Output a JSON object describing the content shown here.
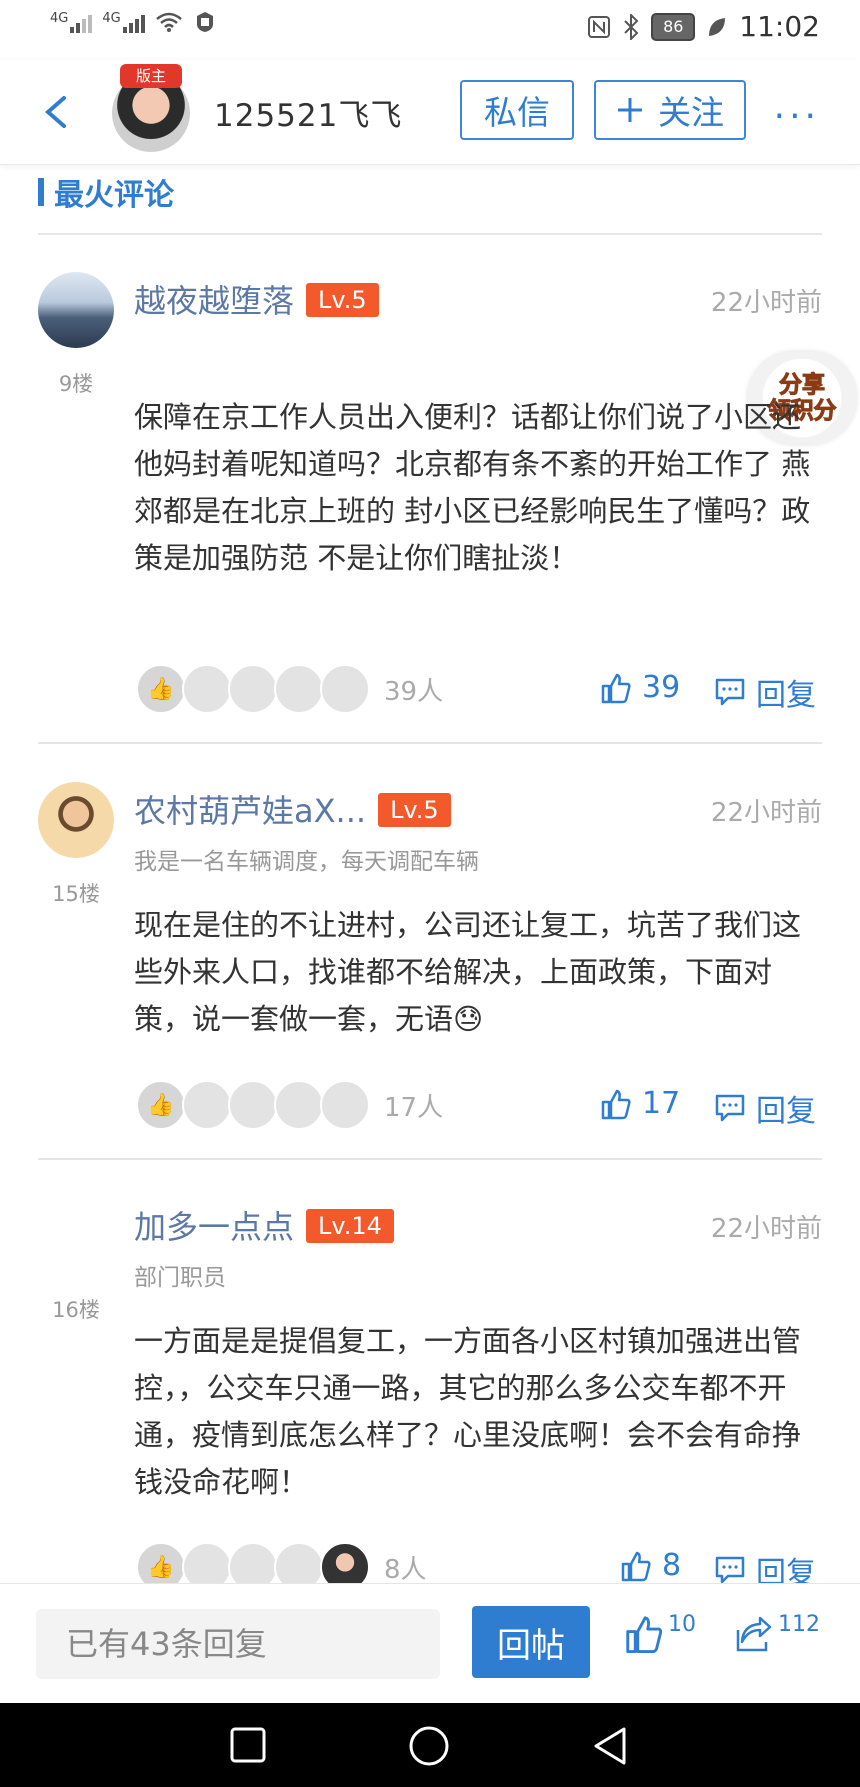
{
  "status_bar": {
    "time": "11:02",
    "battery": "86",
    "signal1": "4G",
    "signal2": "4G"
  },
  "header": {
    "username": "125521飞飞",
    "badge": "版主",
    "message_button": "私信",
    "follow_button": "关注",
    "more": "···"
  },
  "section_title": "最火评论",
  "share_badge": {
    "line1": "分享",
    "line2": "领积分"
  },
  "comments": [
    {
      "name": "越夜越堕落",
      "level": "Lv.5",
      "time": "22小时前",
      "floor": "9楼",
      "subtitle": "",
      "body": "保障在京工作人员出入便利？话都让你们说了小区还他妈封着呢知道吗？北京都有条不紊的开始工作了 燕郊都是在北京上班的 封小区已经影响民生了懂吗？政策是加强防范 不是让你们瞎扯淡！",
      "liker_count": "39人",
      "likes": "39",
      "reply": "回复"
    },
    {
      "name": "农村葫芦娃aX...",
      "level": "Lv.5",
      "time": "22小时前",
      "floor": "15楼",
      "subtitle": "我是一名车辆调度，每天调配车辆",
      "body": "现在是住的不让进村，公司还让复工，坑苦了我们这些外来人口，找谁都不给解决，上面政策，下面对策，说一套做一套，无语😓",
      "liker_count": "17人",
      "likes": "17",
      "reply": "回复"
    },
    {
      "name": "加多一点点",
      "level": "Lv.14",
      "time": "22小时前",
      "floor": "16楼",
      "subtitle": "部门职员",
      "body": "一方面是是提倡复工，一方面各小区村镇加强进出管控，，公交车只通一路，其它的那么多公交车都不开通，疫情到底怎么样了？心里没底啊！会不会有命挣钱没命花啊！",
      "liker_count": "8人",
      "likes": "8",
      "reply": "回复"
    }
  ],
  "bottom_bar": {
    "reply_placeholder": "已有43条回复",
    "post_button": "回帖",
    "like_count": "10",
    "share_count": "112"
  },
  "colors": {
    "accent": "#2f7dd1",
    "level_badge": "#f3592b",
    "name": "#5b78a7"
  }
}
